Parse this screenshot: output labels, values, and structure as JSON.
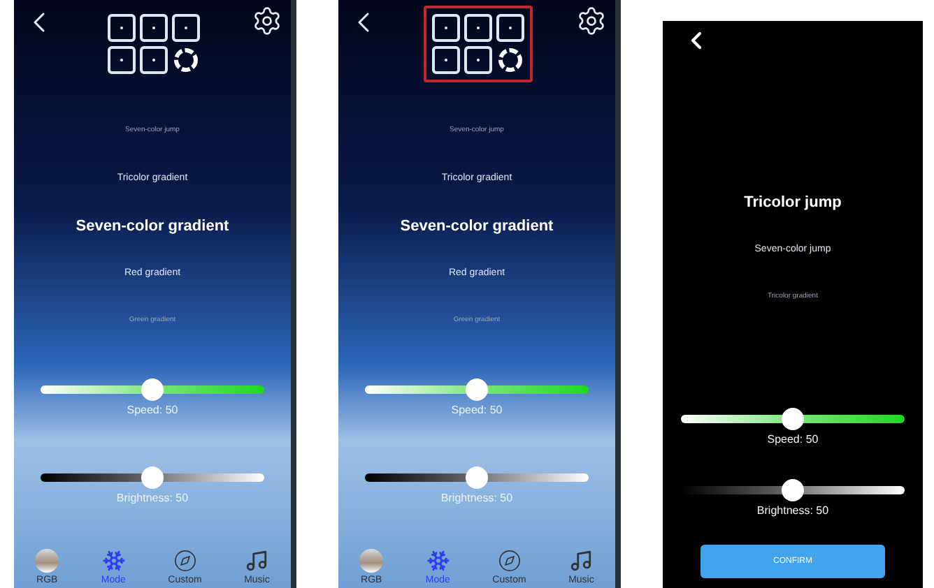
{
  "screens": [
    {
      "kind": "mode",
      "grid_highlighted": false,
      "modes": [
        {
          "label": "Seven-color jump",
          "selected": false
        },
        {
          "label": "Tricolor gradient",
          "selected": false
        },
        {
          "label": "Seven-color gradient",
          "selected": true
        },
        {
          "label": "Red gradient",
          "selected": false
        },
        {
          "label": "Green gradient",
          "selected": false
        }
      ],
      "sliders": [
        {
          "kind": "speed",
          "label": "Speed: 50",
          "level": 0.5
        },
        {
          "kind": "brightness",
          "label": "Brightness: 50",
          "level": 0.5
        }
      ],
      "nav": [
        {
          "kind": "rgb",
          "label": "RGB",
          "selected": false
        },
        {
          "kind": "mode",
          "label": "Mode",
          "selected": true
        },
        {
          "kind": "custom",
          "label": "Custom",
          "selected": false
        },
        {
          "kind": "music",
          "label": "Music",
          "selected": false
        }
      ]
    },
    {
      "kind": "mode",
      "grid_highlighted": true,
      "modes": [
        {
          "label": "Seven-color jump",
          "selected": false
        },
        {
          "label": "Tricolor gradient",
          "selected": false
        },
        {
          "label": "Seven-color gradient",
          "selected": true
        },
        {
          "label": "Red gradient",
          "selected": false
        },
        {
          "label": "Green gradient",
          "selected": false
        }
      ],
      "sliders": [
        {
          "kind": "speed",
          "label": "Speed: 50",
          "level": 0.5
        },
        {
          "kind": "brightness",
          "label": "Brightness: 50",
          "level": 0.5
        }
      ],
      "nav": [
        {
          "kind": "rgb",
          "label": "RGB",
          "selected": false
        },
        {
          "kind": "mode",
          "label": "Mode",
          "selected": true
        },
        {
          "kind": "custom",
          "label": "Custom",
          "selected": false
        },
        {
          "kind": "music",
          "label": "Music",
          "selected": false
        }
      ]
    },
    {
      "kind": "jump",
      "modes": [
        {
          "label": "Tricolor jump",
          "selected": true
        },
        {
          "label": "Seven-color jump",
          "selected": false
        },
        {
          "label": "Tricolor gradient",
          "selected": false
        }
      ],
      "sliders": [
        {
          "kind": "speed",
          "label": "Speed: 50",
          "level": 0.5
        },
        {
          "kind": "brightness",
          "label": "Brightness: 50",
          "level": 0.5
        }
      ],
      "confirm": "CONFIRM"
    }
  ]
}
